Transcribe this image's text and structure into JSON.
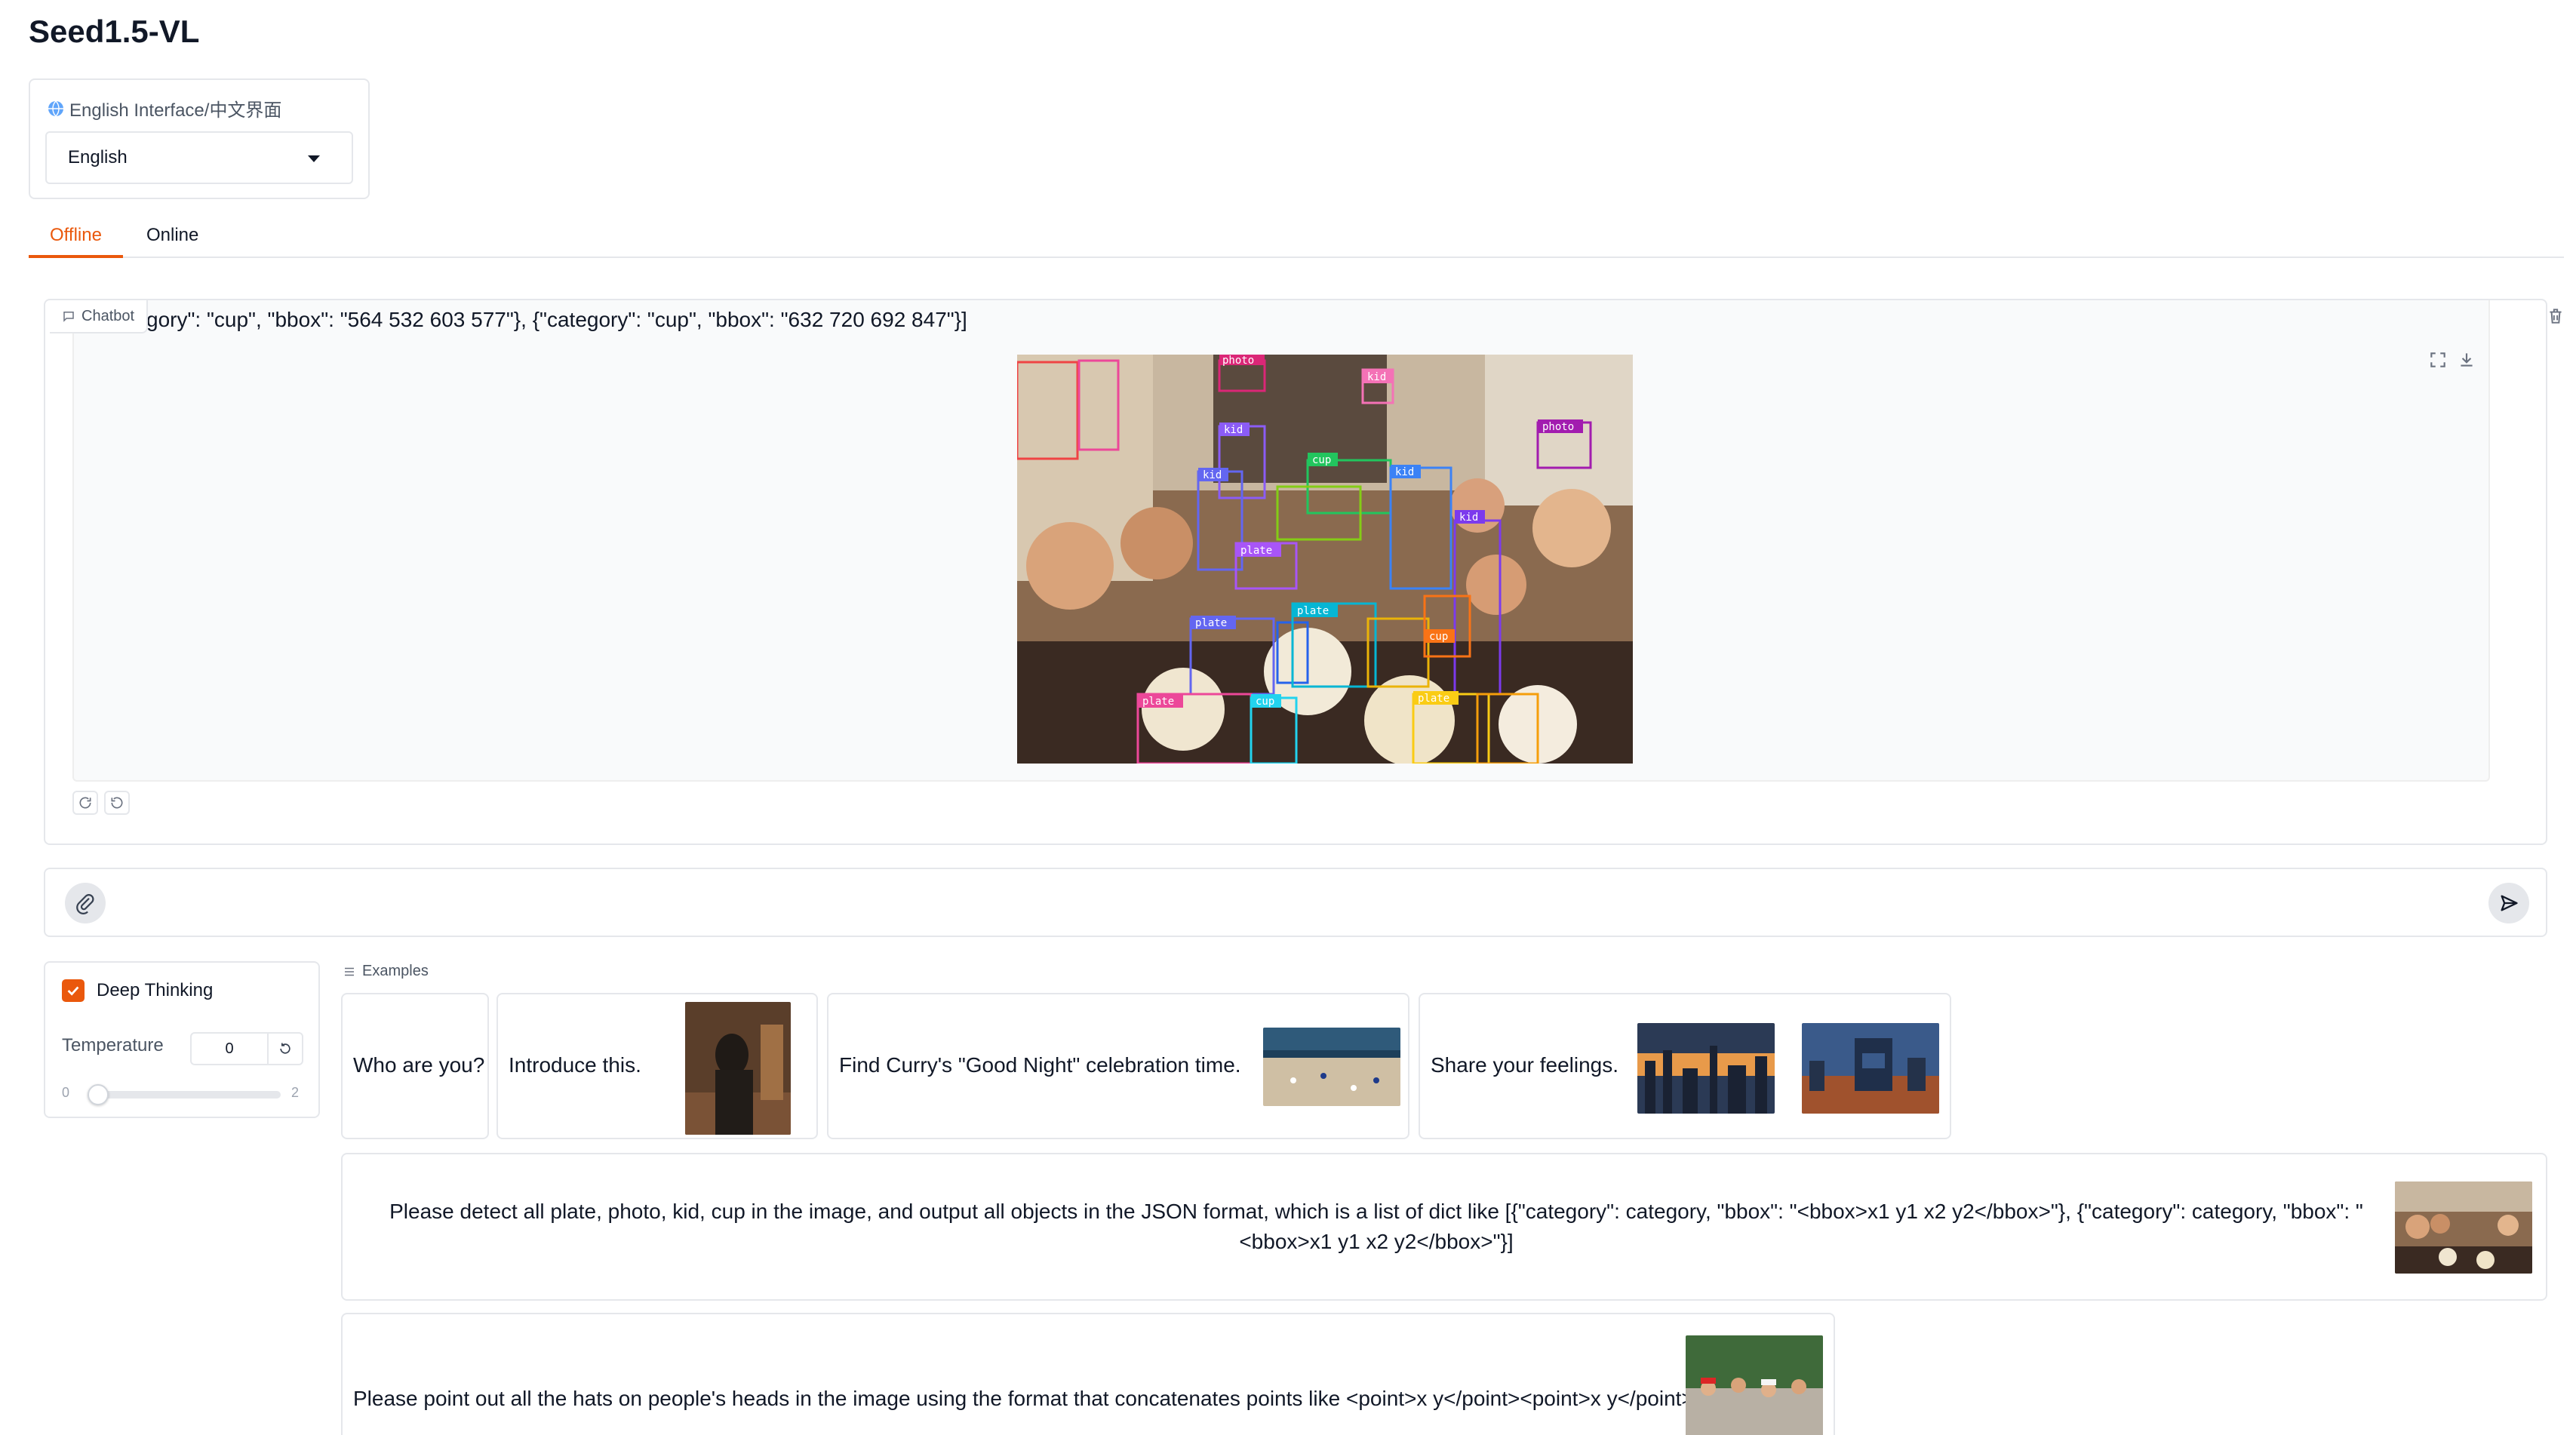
{
  "app": {
    "title": "Seed1.5-VL"
  },
  "language": {
    "label": "English Interface/中文界面",
    "selected": "English"
  },
  "tabs": [
    {
      "label": "Offline",
      "active": true
    },
    {
      "label": "Online",
      "active": false
    }
  ],
  "chatbot": {
    "label": "Chatbot",
    "message_text": "gory\": \"cup\", \"bbox\": \"564 532 603 577\"}, {\"category\": \"cup\", \"bbox\": \"632 720 692 847\"}]",
    "image_labels": [
      "photo",
      "kid",
      "cup",
      "plate"
    ]
  },
  "settings": {
    "deep_thinking_label": "Deep Thinking",
    "deep_thinking_checked": true,
    "temperature_label": "Temperature",
    "temperature_value": "0",
    "slider_min": "0",
    "slider_max": "2",
    "slider_value": 0
  },
  "examples": {
    "label": "Examples",
    "items": [
      {
        "text": "Who are you?"
      },
      {
        "text": "Introduce this."
      },
      {
        "text": "Find Curry's \"Good Night\" celebration time."
      },
      {
        "text": "Share your feelings."
      },
      {
        "text": "Please detect all plate, photo, kid, cup in the image, and output all objects in the JSON format, which is a list of dict like [{\"category\": category, \"bbox\": \"<bbox>x1 y1 x2 y2</bbox>\"}, {\"category\": category, \"bbox\": \"<bbox>x1 y1 x2 y2</bbox>\"}]"
      },
      {
        "text": "Please point out all the hats on people's heads in the image using the format that concatenates points like <point>x y</point><point>x y</point>"
      }
    ]
  },
  "colors": {
    "accent": "#ea580c",
    "border": "#e5e7eb",
    "text": "#111827"
  }
}
